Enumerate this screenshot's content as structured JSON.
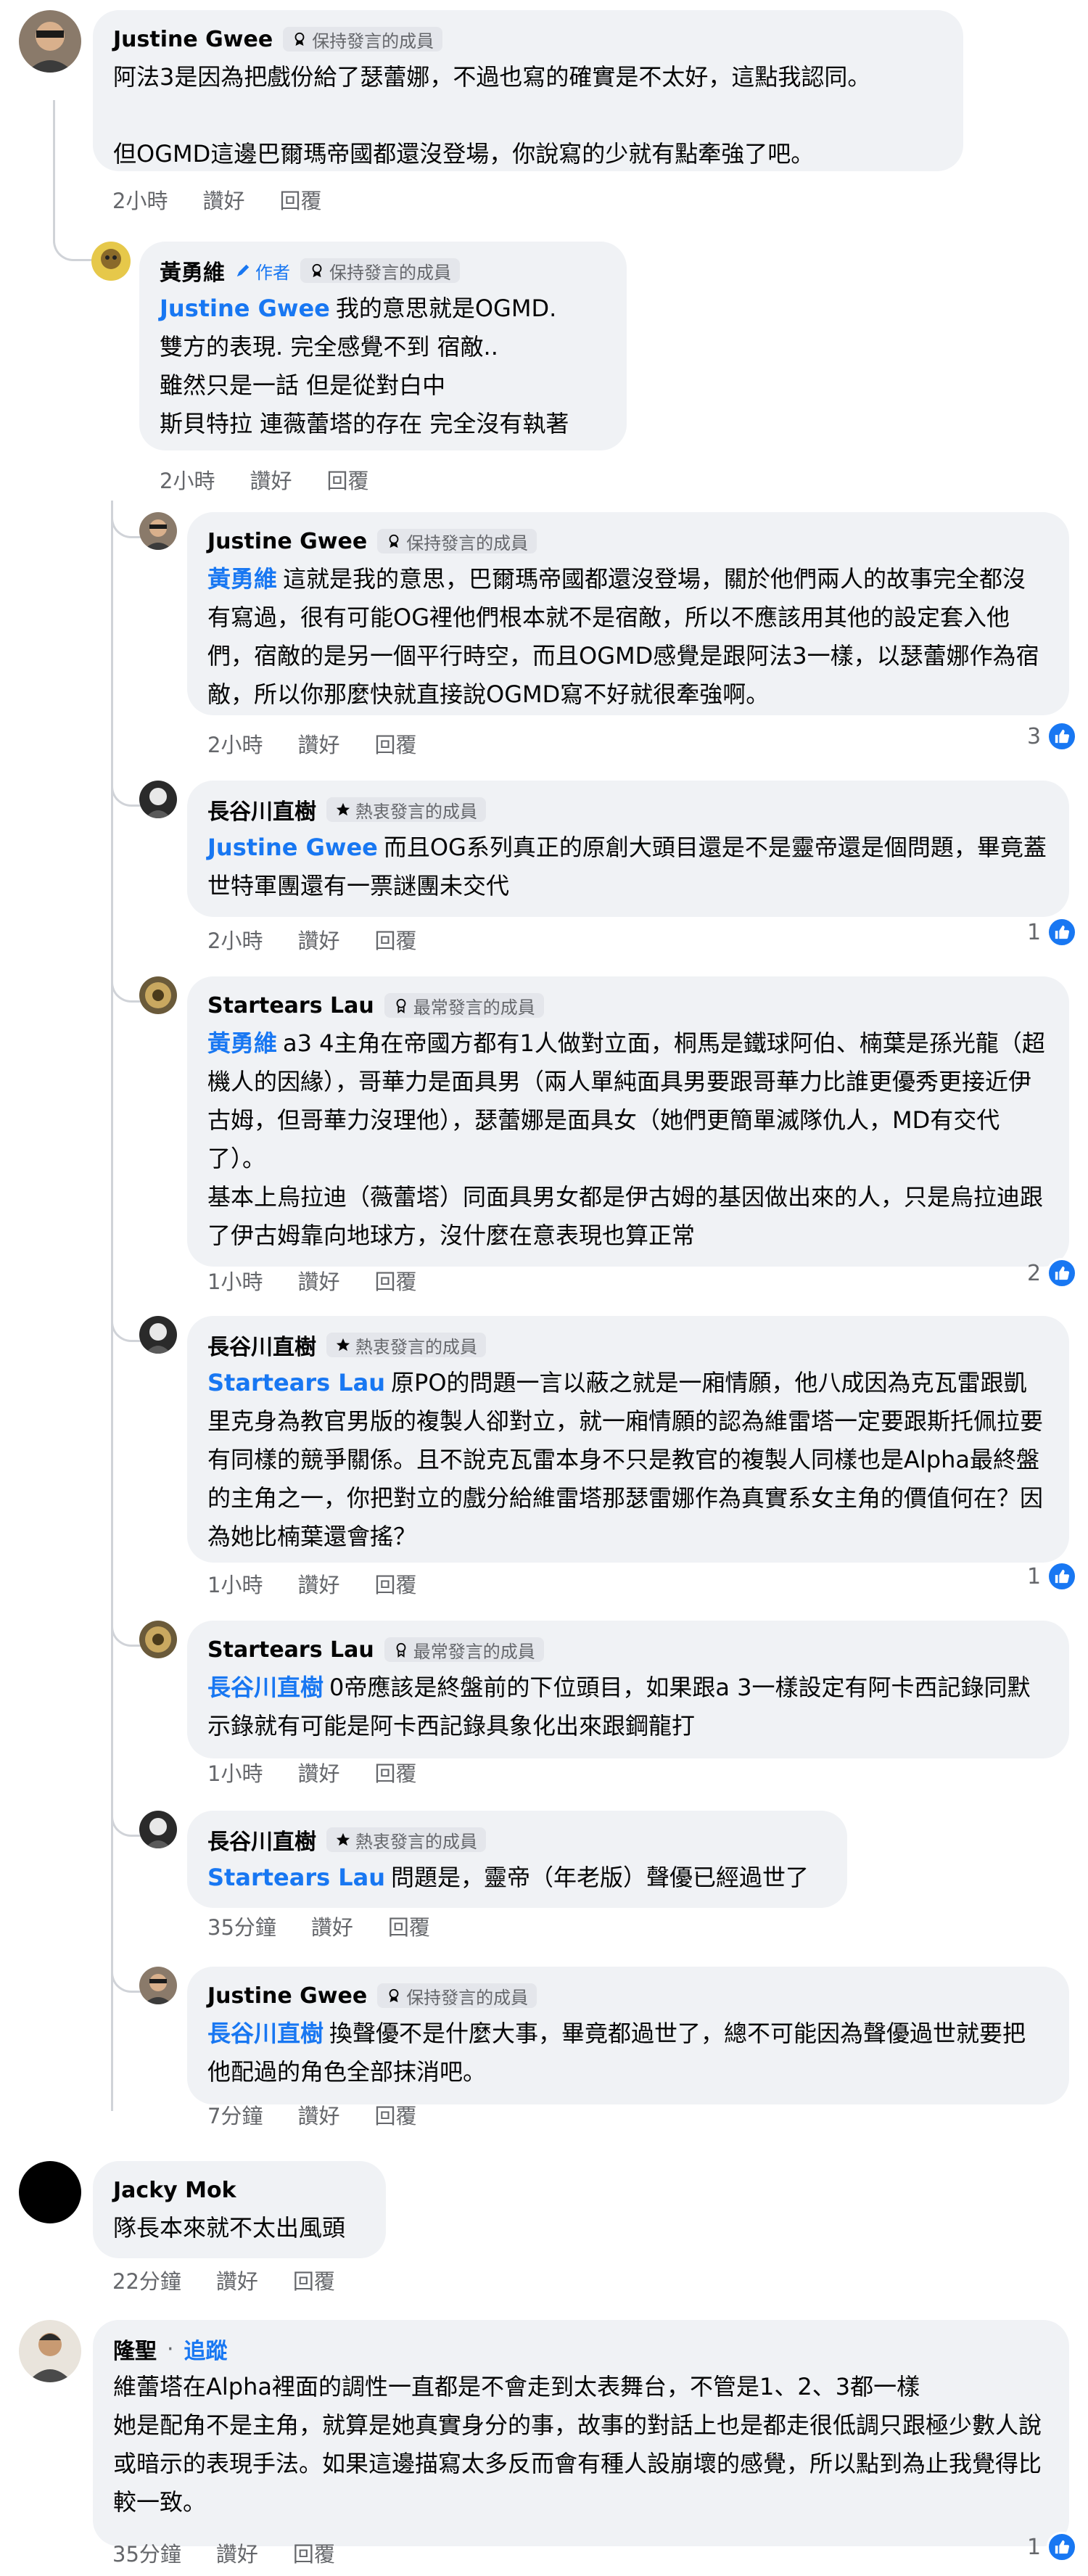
{
  "labels": {
    "like": "讚好",
    "reply": "回覆"
  },
  "comments": [
    {
      "name": "Justine Gwee",
      "badge": "保持發言的成員",
      "time": "2小時",
      "lines": [
        "阿法3是因為把戲份給了瑟蕾娜，不過也寫的確實是不太好，這點我認同。",
        "",
        "但OGMD這邊巴爾瑪帝國都還沒登場，你說寫的少就有點牽強了吧。"
      ]
    },
    {
      "name": "黃勇維",
      "author": "作者",
      "badge": "保持發言的成員",
      "time": "2小時",
      "mention": "Justine Gwee",
      "lines": [
        "我的意思就是OGMD.",
        "雙方的表現. 完全感覺不到 宿敵..",
        "雖然只是一話 但是從對白中",
        "斯貝特拉 連薇蕾塔的存在 完全沒有執著"
      ]
    },
    {
      "name": "Justine Gwee",
      "badge": "保持發言的成員",
      "time": "2小時",
      "count": "3",
      "mention": "黃勇維",
      "lines": [
        "這就是我的意思，巴爾瑪帝國都還沒登場，關於他們兩人的故事完全都沒有寫過，很有可能OG裡他們根本就不是宿敵，所以不應該用其他的設定套入他們，宿敵的是另一個平行時空，而且OGMD感覺是跟阿法3一樣，以瑟蕾娜作為宿敵，所以你那麼快就直接說OGMD寫不好就很牽強啊。"
      ]
    },
    {
      "name": "長谷川直樹",
      "badge": "熱衷發言的成員",
      "time": "2小時",
      "count": "1",
      "mention": "Justine Gwee",
      "lines": [
        "而且OG系列真正的原創大頭目還是不是靈帝還是個問題，畢竟蓋世特軍團還有一票謎團未交代"
      ]
    },
    {
      "name": "Startears Lau",
      "badge": "最常發言的成員",
      "time": "1小時",
      "count": "2",
      "mention": "黃勇維",
      "lines": [
        "a3 4主角在帝國方都有1人做對立面，桐馬是鐵球阿伯、楠葉是孫光龍（超機人的因緣），哥華力是面具男（兩人單純面具男要跟哥華力比誰更優秀更接近伊古姆，但哥華力沒理他），瑟蕾娜是面具女（她們更簡單滅隊仇人，MD有交代了）。",
        "基本上烏拉迪（薇蕾塔）同面具男女都是伊古姆的基因做出來的人，只是烏拉迪跟了伊古姆靠向地球方，沒什麼在意表現也算正常"
      ]
    },
    {
      "name": "長谷川直樹",
      "badge": "熱衷發言的成員",
      "time": "1小時",
      "count": "1",
      "mention": "Startears Lau",
      "lines": [
        "原PO的問題一言以蔽之就是一廂情願，他八成因為克瓦雷跟凱里克身為教官男版的複製人卻對立，就一廂情願的認為維雷塔一定要跟斯托佩拉要有同樣的競爭關係。且不說克瓦雷本身不只是教官的複製人同樣也是Alpha最終盤的主角之一，你把對立的戲分給維雷塔那瑟雷娜作為真實系女主角的價值何在？因為她比楠葉還會搖？"
      ]
    },
    {
      "name": "Startears Lau",
      "badge": "最常發言的成員",
      "time": "1小時",
      "mention": "長谷川直樹",
      "lines": [
        "0帝應該是終盤前的下位頭目，如果跟a 3一樣設定有阿卡西記錄同默示錄就有可能是阿卡西記錄具象化出來跟鋼龍打"
      ]
    },
    {
      "name": "長谷川直樹",
      "badge": "熱衷發言的成員",
      "time": "35分鐘",
      "mention": "Startears Lau",
      "lines": [
        "問題是，靈帝（年老版）聲優已經過世了"
      ]
    },
    {
      "name": "Justine Gwee",
      "badge": "保持發言的成員",
      "time": "7分鐘",
      "mention": "長谷川直樹",
      "lines": [
        "換聲優不是什麼大事，畢竟都過世了，總不可能因為聲優過世就要把他配過的角色全部抹消吧。"
      ]
    },
    {
      "name": "Jacky Mok",
      "time": "22分鐘",
      "lines": [
        "隊長本來就不太出風頭"
      ]
    },
    {
      "name": "隆聖",
      "follow": "追蹤",
      "time": "35分鐘",
      "count": "1",
      "lines": [
        "維蕾塔在Alpha裡面的調性一直都是不會走到太表舞台，不管是1、2、3都一樣",
        "她是配角不是主角，就算是她真實身分的事，故事的對話上也是都走很低調只跟極少數人說或暗示的表現手法。如果這邊描寫太多反而會有種人設崩壞的感覺，所以點到為止我覺得比較一致。"
      ]
    }
  ]
}
